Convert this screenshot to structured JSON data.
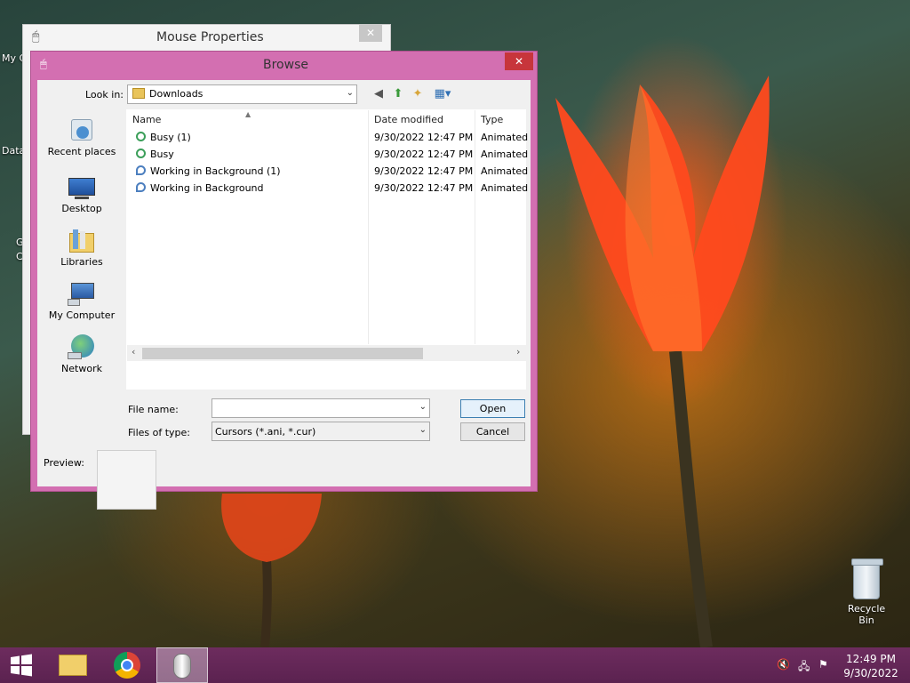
{
  "desktop": {
    "left_icon_labels": [
      "My C",
      "Data",
      "G",
      "C"
    ],
    "recycle_bin_label": "Recycle Bin"
  },
  "mouse_properties": {
    "title": "Mouse Properties",
    "close_glyph": "✕"
  },
  "browse_dialog": {
    "title": "Browse",
    "close_glyph": "✕",
    "look_in_label": "Look in:",
    "look_in_value": "Downloads",
    "places": [
      {
        "label": "Recent places",
        "icon": "recent-places-icon"
      },
      {
        "label": "Desktop",
        "icon": "desktop-icon"
      },
      {
        "label": "Libraries",
        "icon": "libraries-icon"
      },
      {
        "label": "My Computer",
        "icon": "computer-icon"
      },
      {
        "label": "Network",
        "icon": "network-icon"
      }
    ],
    "columns": {
      "name": "Name",
      "date": "Date modified",
      "type": "Type"
    },
    "files": [
      {
        "name": "Busy (1)",
        "date": "9/30/2022 12:47 PM",
        "type": "Animated",
        "icon": "busy-cursor-icon"
      },
      {
        "name": "Busy",
        "date": "9/30/2022 12:47 PM",
        "type": "Animated",
        "icon": "busy-cursor-icon"
      },
      {
        "name": "Working in Background (1)",
        "date": "9/30/2022 12:47 PM",
        "type": "Animated",
        "icon": "working-cursor-icon"
      },
      {
        "name": "Working in Background",
        "date": "9/30/2022 12:47 PM",
        "type": "Animated",
        "icon": "working-cursor-icon"
      }
    ],
    "file_name_label": "File name:",
    "file_name_value": "",
    "files_of_type_label": "Files of type:",
    "files_of_type_value": "Cursors (*.ani, *.cur)",
    "open_label": "Open",
    "cancel_label": "Cancel",
    "preview_label": "Preview:"
  },
  "taskbar": {
    "clock_time": "12:49 PM",
    "clock_date": "9/30/2022",
    "apps": [
      "start-icon",
      "file-explorer-icon",
      "chrome-icon",
      "mouse-icon"
    ]
  },
  "colors": {
    "dialog_frame": "#d36fb1",
    "close_button": "#c7353b",
    "taskbar": "#5b2250"
  }
}
